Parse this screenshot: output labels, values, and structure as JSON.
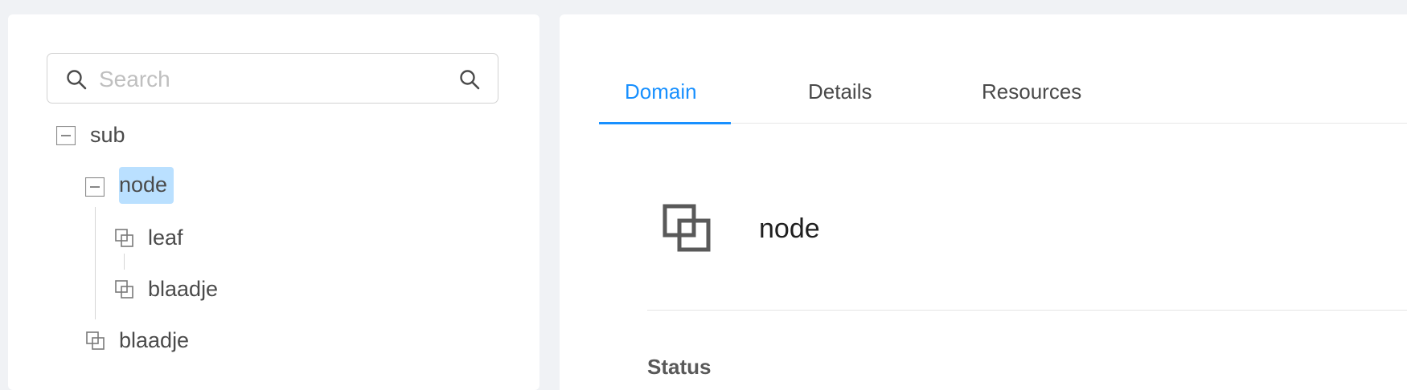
{
  "search": {
    "placeholder": "Search",
    "value": ""
  },
  "tree": {
    "root": {
      "label": "sub"
    },
    "node": {
      "label": "node"
    },
    "node_children": [
      {
        "label": "leaf"
      },
      {
        "label": "blaadje"
      }
    ],
    "sibling": {
      "label": "blaadje"
    }
  },
  "tabs": [
    {
      "label": "Domain"
    },
    {
      "label": "Details"
    },
    {
      "label": "Resources"
    }
  ],
  "detail": {
    "title": "node",
    "status_heading": "Status"
  },
  "colors": {
    "accent": "#1890ff",
    "selected_bg": "#bae0ff",
    "page_bg": "#f0f2f5"
  },
  "icons": {
    "search_left": "search-icon",
    "search_right": "search-icon",
    "expanded_toggle": "minus-square-icon",
    "leaf": "overlapping-squares-icon"
  }
}
